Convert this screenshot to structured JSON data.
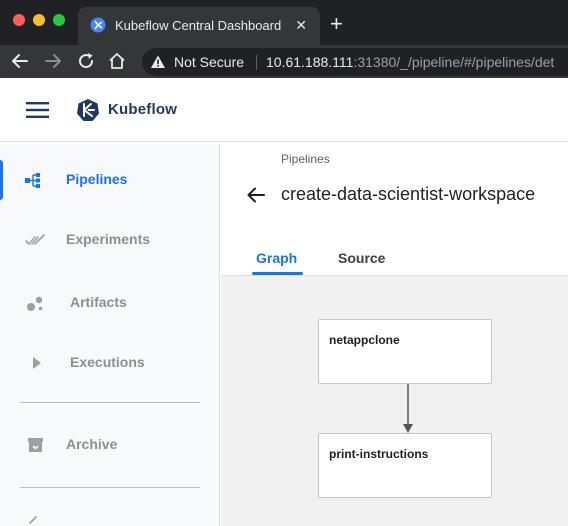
{
  "browser": {
    "tab_title": "Kubeflow Central Dashboard",
    "close_glyph": "✕",
    "newtab_glyph": "+",
    "security_label": "Not Secure",
    "url_host": "10.61.188.111",
    "url_rest": ":31380/_/pipeline/#/pipelines/det"
  },
  "app": {
    "brand": "Kubeflow",
    "accent_color": "#1a73e8"
  },
  "sidebar": {
    "items": [
      {
        "label": "Pipelines",
        "icon": "pipelines-icon",
        "active": true
      },
      {
        "label": "Experiments",
        "icon": "experiments-icon",
        "active": false
      },
      {
        "label": "Artifacts",
        "icon": "artifacts-icon",
        "active": false
      },
      {
        "label": "Executions",
        "icon": "executions-icon",
        "active": false
      },
      {
        "label": "Archive",
        "icon": "archive-icon",
        "active": false
      }
    ]
  },
  "main": {
    "breadcrumb": "Pipelines",
    "title": "create-data-scientist-workspace",
    "tabs": [
      {
        "label": "Graph",
        "active": true
      },
      {
        "label": "Source",
        "active": false
      }
    ]
  },
  "graph": {
    "nodes": [
      {
        "label": "netappclone"
      },
      {
        "label": "print-instructions"
      }
    ],
    "edges": [
      {
        "from": "netappclone",
        "to": "print-instructions"
      }
    ]
  }
}
